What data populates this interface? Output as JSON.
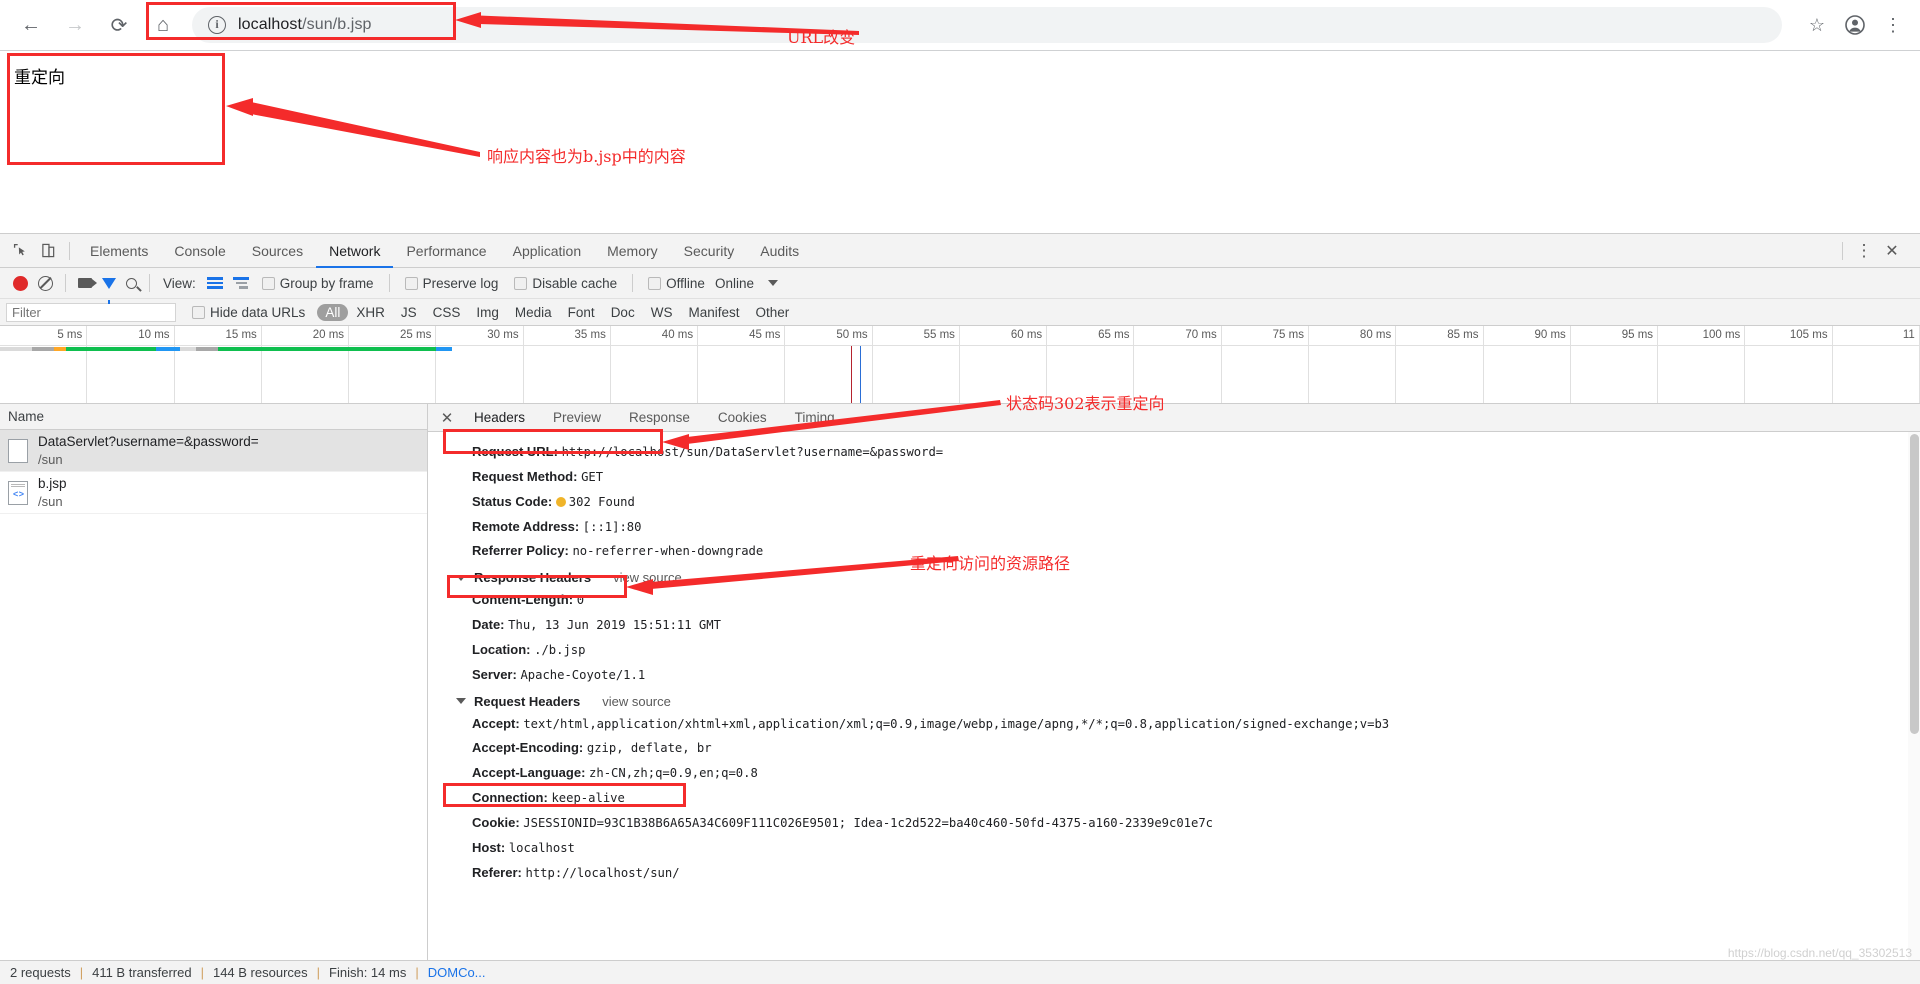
{
  "browser": {
    "nav": {
      "back": "←",
      "forward": "→",
      "reload": "⟳",
      "home": "⌂"
    },
    "url_main": "localhost",
    "url_path": "/sun/b.jsp",
    "info_icon": "i",
    "star_icon": "☆",
    "profile_icon": "●",
    "menu_icon": "⋮"
  },
  "page": {
    "body_text": "重定向"
  },
  "annotations": [
    {
      "id": "a1",
      "text": "URL改变"
    },
    {
      "id": "a2",
      "text": "响应内容也为b.jsp中的内容"
    },
    {
      "id": "a3",
      "text": "状态码302表示重定向"
    },
    {
      "id": "a4",
      "text": "重定向访问的资源路径"
    }
  ],
  "devtools": {
    "tabs": [
      {
        "label": "Elements",
        "active": false
      },
      {
        "label": "Console",
        "active": false
      },
      {
        "label": "Sources",
        "active": false
      },
      {
        "label": "Network",
        "active": true
      },
      {
        "label": "Performance",
        "active": false
      },
      {
        "label": "Application",
        "active": false
      },
      {
        "label": "Memory",
        "active": false
      },
      {
        "label": "Security",
        "active": false
      },
      {
        "label": "Audits",
        "active": false
      }
    ],
    "toolbar": {
      "view_label": "View:",
      "group_by_frame": "Group by frame",
      "preserve_log": "Preserve log",
      "disable_cache": "Disable cache",
      "offline": "Offline",
      "online": "Online"
    },
    "filter": {
      "placeholder": "Filter",
      "hide_data_urls": "Hide data URLs",
      "types": [
        "All",
        "XHR",
        "JS",
        "CSS",
        "Img",
        "Media",
        "Font",
        "Doc",
        "WS",
        "Manifest",
        "Other"
      ],
      "active_type": "All"
    },
    "timeline": {
      "ticks": [
        "5 ms",
        "10 ms",
        "15 ms",
        "20 ms",
        "25 ms",
        "30 ms",
        "35 ms",
        "40 ms",
        "45 ms",
        "50 ms",
        "55 ms",
        "60 ms",
        "65 ms",
        "70 ms",
        "75 ms",
        "80 ms",
        "85 ms",
        "90 ms",
        "95 ms",
        "100 ms",
        "105 ms",
        "11"
      ]
    },
    "requests": {
      "column_header": "Name",
      "rows": [
        {
          "name": "DataServlet?username=&password=",
          "path": "/sun",
          "selected": true,
          "icon": "blank-doc-icon"
        },
        {
          "name": "b.jsp",
          "path": "/sun",
          "selected": false,
          "icon": "code-doc-icon"
        }
      ]
    },
    "detail_tabs": [
      {
        "label": "Headers",
        "active": true
      },
      {
        "label": "Preview",
        "active": false
      },
      {
        "label": "Response",
        "active": false
      },
      {
        "label": "Cookies",
        "active": false
      },
      {
        "label": "Timing",
        "active": false
      }
    ],
    "general": [
      {
        "key": "Request URL:",
        "value": "http://localhost/sun/DataServlet?username=&password="
      },
      {
        "key": "Request Method:",
        "value": "GET"
      },
      {
        "key": "Status Code:",
        "value": "302 Found",
        "has_status_dot": true
      },
      {
        "key": "Remote Address:",
        "value": "[::1]:80"
      },
      {
        "key": "Referrer Policy:",
        "value": "no-referrer-when-downgrade"
      }
    ],
    "response_headers_title": "Response Headers",
    "view_source": "view source",
    "response_headers": [
      {
        "key": "Content-Length:",
        "value": "0"
      },
      {
        "key": "Date:",
        "value": "Thu, 13 Jun 2019 15:51:11 GMT"
      },
      {
        "key": "Location:",
        "value": "./b.jsp"
      },
      {
        "key": "Server:",
        "value": "Apache-Coyote/1.1"
      }
    ],
    "request_headers_title": "Request Headers",
    "request_headers": [
      {
        "key": "Accept:",
        "value": "text/html,application/xhtml+xml,application/xml;q=0.9,image/webp,image/apng,*/*;q=0.8,application/signed-exchange;v=b3"
      },
      {
        "key": "Accept-Encoding:",
        "value": "gzip, deflate, br"
      },
      {
        "key": "Accept-Language:",
        "value": "zh-CN,zh;q=0.9,en;q=0.8"
      },
      {
        "key": "Connection:",
        "value": "keep-alive"
      },
      {
        "key": "Cookie:",
        "value": "JSESSIONID=93C1B38B6A65A34C609F111C026E9501; Idea-1c2d522=ba40c460-50fd-4375-a160-2339e9c01e7c"
      },
      {
        "key": "Host:",
        "value": "localhost"
      },
      {
        "key": "Referer:",
        "value": "http://localhost/sun/"
      }
    ],
    "status_bar": {
      "requests": "2 requests",
      "transferred": "411 B transferred",
      "resources": "144 B resources",
      "finish": "Finish: 14 ms",
      "domcontent": "DOMCo..."
    }
  },
  "watermark": "https://blog.csdn.net/qq_35302513",
  "colors": {
    "accent_blue": "#1a73e8",
    "annotation_red": "#f42b2b",
    "status_amber": "#f0b429",
    "waterfall_green": "#0fbf4f",
    "waterfall_blue": "#2196f3",
    "waterfall_orange": "#ffa726",
    "waterfall_gray": "#a8a8a8"
  }
}
